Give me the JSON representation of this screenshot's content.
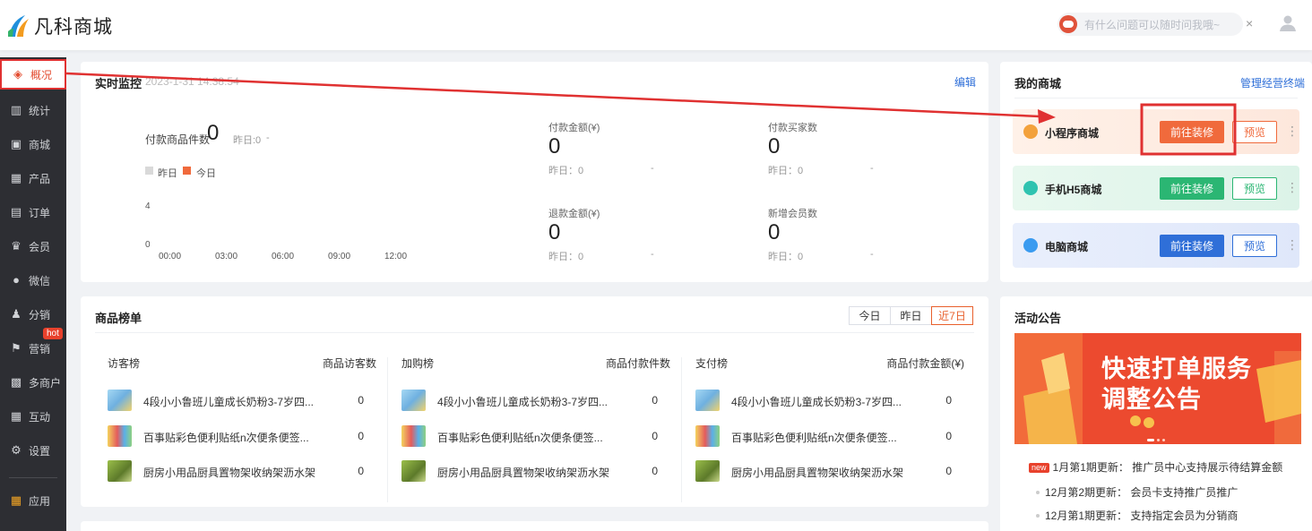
{
  "brand": {
    "name": "凡科商城"
  },
  "header": {
    "assistant_placeholder": "有什么问题可以随时问我哦~",
    "close": "×"
  },
  "sidebar": {
    "items": [
      {
        "label": "概况",
        "icon": "layers-icon",
        "active": true
      },
      {
        "label": "统计",
        "icon": "stats-icon"
      },
      {
        "label": "商城",
        "icon": "shop-icon"
      },
      {
        "label": "产品",
        "icon": "grid-icon"
      },
      {
        "label": "订单",
        "icon": "clipboard-icon"
      },
      {
        "label": "会员",
        "icon": "crown-icon"
      },
      {
        "label": "微信",
        "icon": "wechat-icon"
      },
      {
        "label": "分销",
        "icon": "users-icon"
      },
      {
        "label": "营销",
        "icon": "flag-icon",
        "badge": "hot"
      },
      {
        "label": "多商户",
        "icon": "stores-icon"
      },
      {
        "label": "互动",
        "icon": "interact-icon"
      },
      {
        "label": "设置",
        "icon": "gear-icon"
      },
      {
        "label": "应用",
        "icon": "apps-icon"
      }
    ]
  },
  "monitor": {
    "title": "实时监控",
    "timestamp": "2023-1-31 14:38:54",
    "edit": "编辑",
    "paid_items_label": "付款商品件数",
    "paid_items_value": "0",
    "paid_items_yesterday": "昨日:0",
    "paid_items_dash": "-",
    "legend_yesterday": "昨日",
    "legend_today": "今日",
    "y_ticks": [
      "4",
      "0"
    ],
    "x_ticks": [
      "00:00",
      "03:00",
      "06:00",
      "09:00",
      "12:00"
    ],
    "stats": [
      {
        "label": "付款金额(¥)",
        "value": "0",
        "yesterday": "昨日：0",
        "dash": "-"
      },
      {
        "label": "付款买家数",
        "value": "0",
        "yesterday": "昨日：0",
        "dash": "-"
      },
      {
        "label": "退款金额(¥)",
        "value": "0",
        "yesterday": "昨日：0",
        "dash": "-"
      },
      {
        "label": "新增会员数",
        "value": "0",
        "yesterday": "昨日：0",
        "dash": "-"
      }
    ]
  },
  "my_shop": {
    "title": "我的商城",
    "manage_link": "管理经营终端",
    "shops": [
      {
        "name": "小程序商城",
        "go": "前往装修",
        "preview": "预览",
        "color": "#f06a3c"
      },
      {
        "name": "手机H5商城",
        "go": "前往装修",
        "preview": "预览",
        "color": "#2bb673"
      },
      {
        "name": "电脑商城",
        "go": "前往装修",
        "preview": "预览",
        "color": "#2f6fd8"
      }
    ]
  },
  "ranking": {
    "title": "商品榜单",
    "tabs": [
      "今日",
      "昨日",
      "近7日"
    ],
    "active_tab": "近7日",
    "columns": [
      {
        "name": "访客榜",
        "metric": "商品访客数",
        "items": [
          {
            "name": "4段小小鲁班儿童成长奶粉3-7岁四...",
            "value": "0"
          },
          {
            "name": "百事贴彩色便利贴纸n次便条便签...",
            "value": "0"
          },
          {
            "name": "厨房小用品厨具置物架收纳架沥水架",
            "value": "0"
          }
        ]
      },
      {
        "name": "加购榜",
        "metric": "商品付款件数",
        "items": [
          {
            "name": "4段小小鲁班儿童成长奶粉3-7岁四...",
            "value": "0"
          },
          {
            "name": "百事贴彩色便利贴纸n次便条便签...",
            "value": "0"
          },
          {
            "name": "厨房小用品厨具置物架收纳架沥水架",
            "value": "0"
          }
        ]
      },
      {
        "name": "支付榜",
        "metric": "商品付款金额(¥)",
        "items": [
          {
            "name": "4段小小鲁班儿童成长奶粉3-7岁四...",
            "value": "0"
          },
          {
            "name": "百事贴彩色便利贴纸n次便条便签...",
            "value": "0"
          },
          {
            "name": "厨房小用品厨具置物架收纳架沥水架",
            "value": "0"
          }
        ]
      }
    ]
  },
  "announcements": {
    "title": "活动公告",
    "banner_line1": "快速打单服务",
    "banner_line2": "调整公告",
    "new_tag": "new",
    "items": [
      "1月第1期更新： 推广员中心支持展示待结算金额",
      "12月第2期更新： 会员卡支持推广员推广",
      "12月第1期更新： 支持指定会员为分销商"
    ]
  },
  "colors": {
    "accent": "#e8602c",
    "sidebar_bg": "#2d2e33",
    "highlight": "#e03131"
  }
}
